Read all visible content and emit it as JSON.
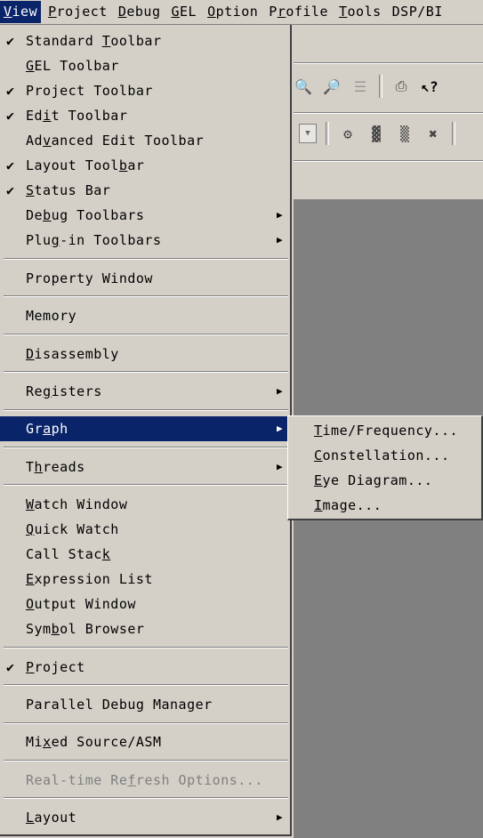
{
  "menubar": {
    "items": [
      {
        "label": "View",
        "accel": "V",
        "rest": "iew"
      },
      {
        "label": "Project",
        "accel": "P",
        "rest": "roject"
      },
      {
        "label": "Debug",
        "accel": "D",
        "rest": "ebug"
      },
      {
        "label": "GEL",
        "accel": "G",
        "rest": "EL"
      },
      {
        "label": "Option",
        "accel": "O",
        "rest": "ption"
      },
      {
        "label": "Profile",
        "accel": "r",
        "pre": "P",
        "rest": "ofile"
      },
      {
        "label": "Tools",
        "accel": "T",
        "rest": "ools"
      },
      {
        "label": "DSP/BI",
        "accel": "",
        "rest": "DSP/BI"
      }
    ]
  },
  "view_menu": {
    "items": [
      {
        "pre": "",
        "accel": "",
        "post": "Standard ",
        "post2_u": "T",
        "post2": "oolbar",
        "checked": true
      },
      {
        "pre": "",
        "accel": "G",
        "post": "EL Toolbar",
        "checked": false
      },
      {
        "pre": "",
        "accel": "",
        "post": "Project Toolbar",
        "checked": true
      },
      {
        "pre": "Ed",
        "accel": "i",
        "post": "t Toolbar",
        "checked": true
      },
      {
        "pre": "Ad",
        "accel": "v",
        "post": "anced Edit Toolbar",
        "checked": false
      },
      {
        "pre": "Layout Tool",
        "accel": "b",
        "post": "ar",
        "checked": true
      },
      {
        "pre": "",
        "accel": "S",
        "post": "tatus Bar",
        "checked": true
      },
      {
        "pre": "De",
        "accel": "b",
        "post": "ug Toolbars",
        "checked": false,
        "submenu": true
      },
      {
        "pre": "Plu",
        "accel": "g",
        "post": "-in Toolbars",
        "checked": false,
        "submenu": true
      },
      {
        "pre": "Property Window",
        "accel": "",
        "post": "",
        "checked": false
      },
      {
        "pre": "Memory",
        "accel": "",
        "post": "",
        "checked": false
      },
      {
        "pre": "",
        "accel": "D",
        "post": "isassembly",
        "checked": false
      },
      {
        "pre": "Re",
        "accel": "g",
        "post": "isters",
        "checked": false,
        "submenu": true
      },
      {
        "pre": "Gr",
        "accel": "a",
        "post": "ph",
        "checked": false,
        "submenu": true,
        "highlighted": true
      },
      {
        "pre": "T",
        "accel": "h",
        "post": "reads",
        "checked": false,
        "submenu": true
      },
      {
        "pre": "",
        "accel": "W",
        "post": "atch Window",
        "checked": false
      },
      {
        "pre": "",
        "accel": "Q",
        "post": "uick Watch",
        "checked": false
      },
      {
        "pre": "Call Stac",
        "accel": "k",
        "post": "",
        "checked": false
      },
      {
        "pre": "",
        "accel": "E",
        "post": "xpression List",
        "checked": false
      },
      {
        "pre": "",
        "accel": "O",
        "post": "utput Window",
        "checked": false
      },
      {
        "pre": "Sym",
        "accel": "b",
        "post": "ol Browser",
        "checked": false
      },
      {
        "pre": "",
        "accel": "P",
        "post": "roject",
        "checked": true
      },
      {
        "pre": "Parallel Debug Manager",
        "accel": "",
        "post": "",
        "checked": false
      },
      {
        "pre": "Mi",
        "accel": "x",
        "post": "ed Source/ASM",
        "checked": false
      },
      {
        "pre": "Real-time Re",
        "accel": "f",
        "post": "resh Options...",
        "checked": false,
        "disabled": true
      },
      {
        "pre": "",
        "accel": "L",
        "post": "ayout",
        "checked": false,
        "submenu": true
      }
    ]
  },
  "graph_submenu": {
    "items": [
      {
        "pre": "",
        "accel": "T",
        "post": "ime/Frequency..."
      },
      {
        "pre": "",
        "accel": "C",
        "post": "onstellation..."
      },
      {
        "pre": "",
        "accel": "E",
        "post": "ye Diagram..."
      },
      {
        "pre": "",
        "accel": "I",
        "post": "mage..."
      }
    ]
  },
  "icons": {
    "checkmark": "check-icon",
    "submenu_arrow": "triangle-right-icon"
  },
  "colors": {
    "menu_bg": "#d4d0c8",
    "highlight": "#0a246a",
    "workspace": "#808080"
  }
}
